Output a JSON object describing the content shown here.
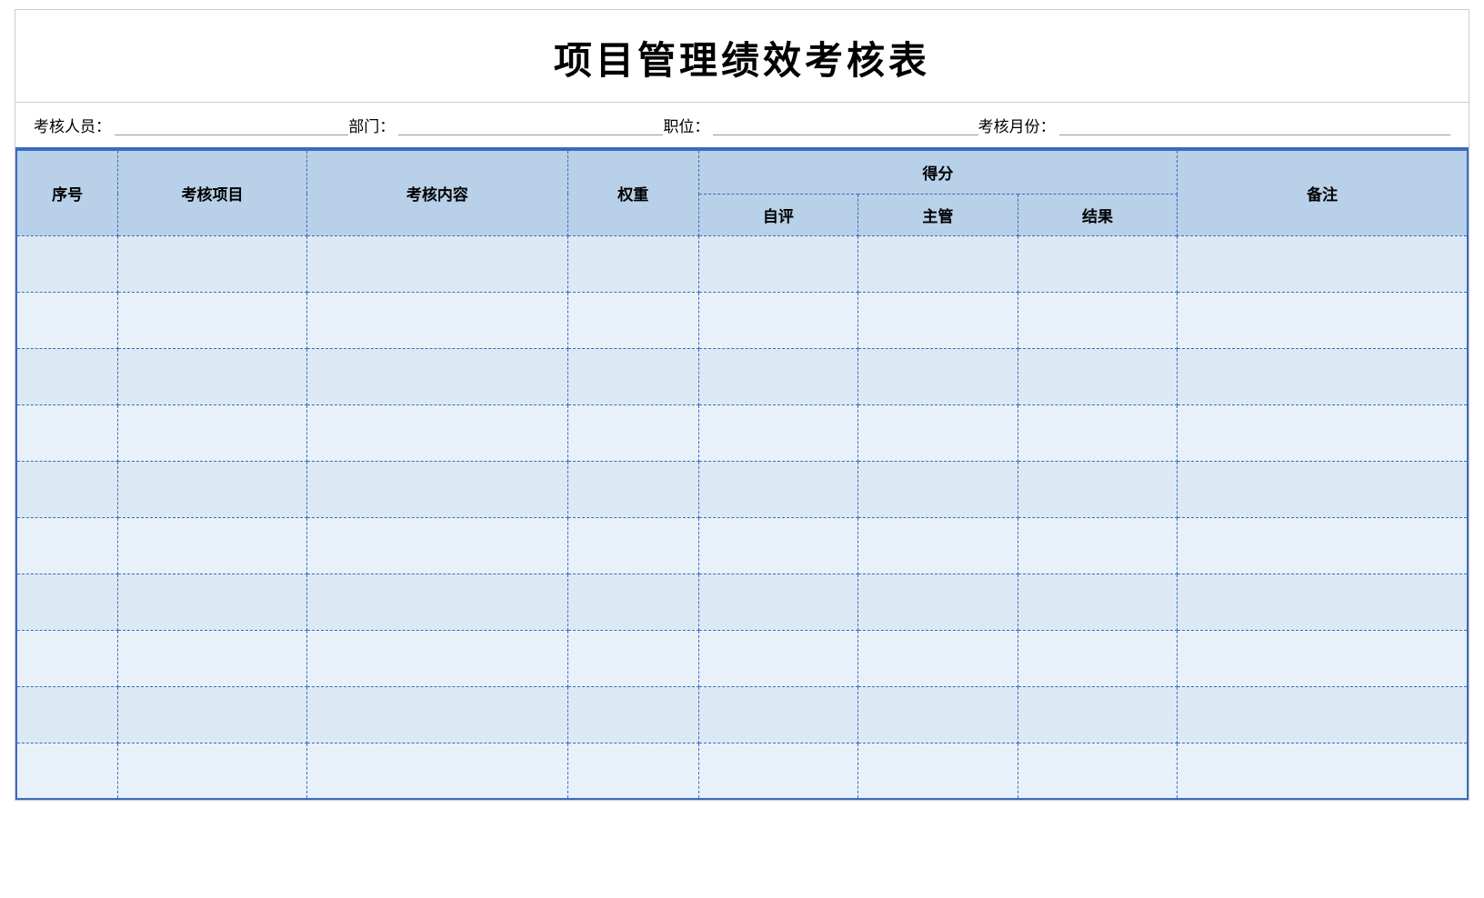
{
  "page": {
    "title": "项目管理绩效考核表",
    "info": {
      "reviewer_label": "考核人员：",
      "department_label": "部门：",
      "position_label": "职位：",
      "month_label": "考核月份："
    },
    "table": {
      "headers": {
        "seq": "序号",
        "item": "考核项目",
        "content": "考核内容",
        "weight": "权重",
        "score_group": "得分",
        "self_eval": "自评",
        "supervisor": "主管",
        "result": "结果",
        "note": "备注"
      },
      "data_rows": 10
    }
  }
}
